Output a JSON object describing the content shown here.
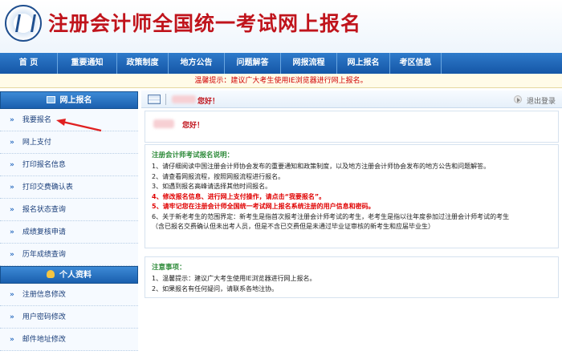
{
  "header": {
    "title": "注册会计师全国统一考试网上报名"
  },
  "nav": [
    {
      "label": "首 页",
      "w": 72
    },
    {
      "label": "重要通知",
      "w": 74
    },
    {
      "label": "政策制度",
      "w": 64
    },
    {
      "label": "地方公告",
      "w": 70
    },
    {
      "label": "问题解答",
      "w": 70
    },
    {
      "label": "网报流程",
      "w": 70
    },
    {
      "label": "网上报名",
      "w": 66
    },
    {
      "label": "考区信息",
      "w": 64
    }
  ],
  "notice": "温馨提示：建议广大考生使用IE浏览器进行网上报名。",
  "sidebar": {
    "section1": "网上报名",
    "items1": [
      "我要报名",
      "网上支付",
      "打印报名信息",
      "打印交费确认表",
      "报名状态查询",
      "成绩复核申请",
      "历年成绩查询"
    ],
    "section2": "个人资料",
    "items2": [
      "注册信息修改",
      "用户密码修改",
      "邮件地址修改"
    ]
  },
  "topbar": {
    "greeting": "您好！",
    "logout": "退出登录"
  },
  "hello": "您好！",
  "instructions": {
    "title": "注册会计师考试报名说明：",
    "lines": [
      {
        "text": "1、请仔细阅读中国注册会计师协会发布的重要通知和政策制度，以及地方注册会计师协会发布的地方公告和问题解答。",
        "red": false
      },
      {
        "text": "2、请查看网报流程，按照网报流程进行报名。",
        "red": false
      },
      {
        "text": "3、如遇到报名高峰请选择其他时间报名。",
        "red": false
      },
      {
        "text": "4、修改报名信息、进行网上支付操作，请点击“我要报名”。",
        "red": true
      },
      {
        "text": "5、请牢记您在注册会计师全国统一考试网上报名系统注册的用户信息和密码。",
        "red": true
      },
      {
        "text": "6、关于新老考生的范围界定：新考生是指首次报考注册会计师考试的考生，老考生是指以往年度参加过注册会计师考试的考生",
        "red": false
      },
      {
        "text": "（含已报名交费确认但未出考人员，但是不含已交费但是未通过毕业证审核的新考生和应届毕业生）",
        "red": false
      }
    ]
  },
  "notes": {
    "title": "注意事项：",
    "lines": [
      "1、温馨提示：建议广大考生使用IE浏览器进行网上报名。",
      "2、如果报名有任何疑问，请联系各地注协。"
    ]
  },
  "colors": {
    "nav_blue": "#1f67b8",
    "title_red": "#c0141c",
    "notice_red": "#d00000",
    "section_green": "#2e8b3a"
  }
}
